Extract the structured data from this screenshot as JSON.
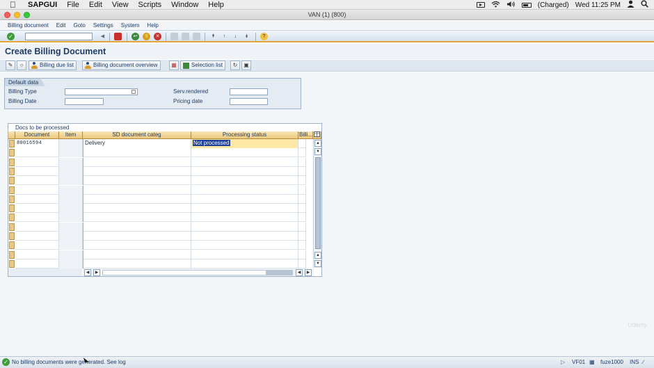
{
  "macmenu": {
    "app": "SAPGUI",
    "items": [
      "File",
      "Edit",
      "View",
      "Scripts",
      "Window",
      "Help"
    ],
    "battery": "(Charged)",
    "clock": "Wed 11:25 PM"
  },
  "window": {
    "title": "VAN (1) (800)"
  },
  "sapmenu": {
    "items": [
      "Billing document",
      "Edit",
      "Goto",
      "Settings",
      "System",
      "Help"
    ]
  },
  "page": {
    "title": "Create Billing Document"
  },
  "apptoolbar": {
    "billing_due_list": "Billing due list",
    "billing_doc_overview": "Billing document overview",
    "selection_list": "Selection list"
  },
  "default_data": {
    "title": "Default data",
    "billing_type_label": "Billing Type",
    "billing_type_value": "",
    "billing_date_label": "Billing Date",
    "billing_date_value": "",
    "serv_rendered_label": "Serv.rendered",
    "serv_rendered_value": "",
    "pricing_date_label": "Pricing date",
    "pricing_date_value": ""
  },
  "table": {
    "title": "Docs to be processed",
    "columns": [
      "Document",
      "Item",
      "SD document categ",
      "Processing status",
      "Billi..."
    ],
    "rows": [
      {
        "document": "80016594",
        "item": "",
        "category": "Delivery",
        "status": "Not processed"
      }
    ],
    "empty_rows": 13
  },
  "statusbar": {
    "message": "No billing documents were generated. See log",
    "system": "VF01",
    "server": "fuze1000",
    "mode": "INS"
  },
  "watermark": "Udemy",
  "colors": {
    "title_blue": "#1e3b66",
    "toolbar_orange": "#e5a33b",
    "selected_status": "#1d3f95",
    "header_gold": "#ecc77c"
  }
}
